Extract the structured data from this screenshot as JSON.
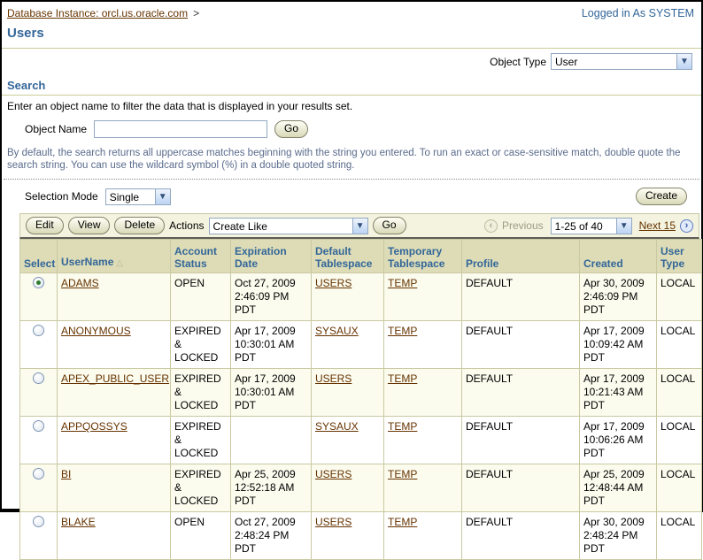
{
  "header": {
    "breadcrumb": "Database Instance: orcl.us.oracle.com",
    "breadcrumb_sep": ">",
    "logged_in": "Logged in As SYSTEM",
    "title": "Users",
    "object_type_label": "Object Type",
    "object_type_value": "User"
  },
  "search": {
    "heading": "Search",
    "instruction": "Enter an object name to filter the data that is displayed in your results set.",
    "object_name_label": "Object Name",
    "object_name_value": "",
    "go_label": "Go",
    "hint": "By default, the search returns all uppercase matches beginning with the string you entered. To run an exact or case-sensitive match, double quote the search string. You can use the wildcard symbol (%) in a double quoted string."
  },
  "selection": {
    "label": "Selection Mode",
    "value": "Single",
    "create_label": "Create"
  },
  "toolbar": {
    "edit_label": "Edit",
    "view_label": "View",
    "delete_label": "Delete",
    "actions_label": "Actions",
    "actions_value": "Create Like",
    "go_label": "Go",
    "previous_icon": "‹",
    "previous_label": "Previous",
    "range_value": "1-25 of 40",
    "next_label": "Next 15",
    "next_icon": "›"
  },
  "table": {
    "columns": {
      "select": "Select",
      "username": "UserName",
      "account_status": "Account Status",
      "expiration": "Expiration Date",
      "default_ts": "Default Tablespace",
      "temp_ts": "Temporary Tablespace",
      "profile": "Profile",
      "created": "Created",
      "user_type": "User Type"
    },
    "sort_indicator": "△",
    "rows": [
      {
        "selected": true,
        "username": "ADAMS",
        "account_status": "OPEN",
        "expiration": "Oct 27, 2009 2:46:09 PM PDT",
        "default_ts": "USERS",
        "temp_ts": "TEMP",
        "profile": "DEFAULT",
        "created": "Apr 30, 2009 2:46:09 PM PDT",
        "user_type": "LOCAL"
      },
      {
        "selected": false,
        "username": "ANONYMOUS",
        "account_status": "EXPIRED & LOCKED",
        "expiration": "Apr 17, 2009 10:30:01 AM PDT",
        "default_ts": "SYSAUX",
        "temp_ts": "TEMP",
        "profile": "DEFAULT",
        "created": "Apr 17, 2009 10:09:42 AM PDT",
        "user_type": "LOCAL"
      },
      {
        "selected": false,
        "username": "APEX_PUBLIC_USER",
        "account_status": "EXPIRED & LOCKED",
        "expiration": "Apr 17, 2009 10:30:01 AM PDT",
        "default_ts": "USERS",
        "temp_ts": "TEMP",
        "profile": "DEFAULT",
        "created": "Apr 17, 2009 10:21:43 AM PDT",
        "user_type": "LOCAL"
      },
      {
        "selected": false,
        "username": "APPQOSSYS",
        "account_status": "EXPIRED & LOCKED",
        "expiration": "",
        "default_ts": "SYSAUX",
        "temp_ts": "TEMP",
        "profile": "DEFAULT",
        "created": "Apr 17, 2009 10:06:26 AM PDT",
        "user_type": "LOCAL"
      },
      {
        "selected": false,
        "username": "BI",
        "account_status": "EXPIRED & LOCKED",
        "expiration": "Apr 25, 2009 12:52:18 AM PDT",
        "default_ts": "USERS",
        "temp_ts": "TEMP",
        "profile": "DEFAULT",
        "created": "Apr 25, 2009 12:48:44 AM PDT",
        "user_type": "LOCAL"
      },
      {
        "selected": false,
        "username": "BLAKE",
        "account_status": "OPEN",
        "expiration": "Oct 27, 2009 2:48:24 PM PDT",
        "default_ts": "USERS",
        "temp_ts": "TEMP",
        "profile": "DEFAULT",
        "created": "Apr 30, 2009 2:48:24 PM PDT",
        "user_type": "LOCAL"
      }
    ]
  }
}
